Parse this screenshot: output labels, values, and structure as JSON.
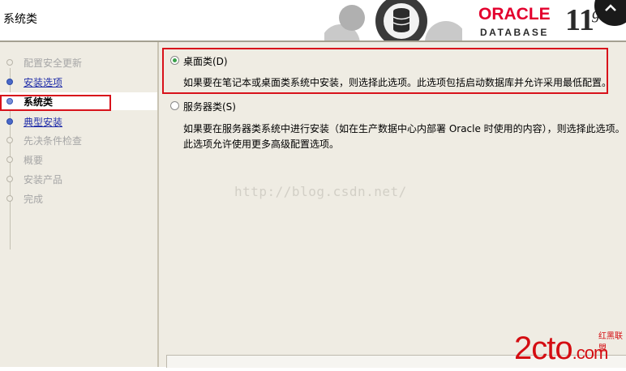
{
  "header": {
    "title": "系统类",
    "brand": "ORACLE",
    "product": "DATABASE",
    "version": "11",
    "version_suffix": "g"
  },
  "nav": {
    "steps": [
      {
        "label": "配置安全更新",
        "state": "done"
      },
      {
        "label": "安装选项",
        "state": "link"
      },
      {
        "label": "系统类",
        "state": "current"
      },
      {
        "label": "典型安装",
        "state": "link"
      },
      {
        "label": "先决条件检查",
        "state": "pending"
      },
      {
        "label": "概要",
        "state": "pending"
      },
      {
        "label": "安装产品",
        "state": "pending"
      },
      {
        "label": "完成",
        "state": "pending"
      }
    ]
  },
  "options": {
    "desktop": {
      "label": "桌面类(D)",
      "selected": true,
      "description": "如果要在笔记本或桌面类系统中安装，则选择此选项。此选项包括启动数据库并允许采用最低配置。"
    },
    "server": {
      "label": "服务器类(S)",
      "selected": false,
      "description_line1": "如果要在服务器类系统中进行安装（如在生产数据中心内部署 Oracle 时使用的内容），则选择此选项。",
      "description_line2": "此选项允许使用更多高级配置选项。"
    }
  },
  "watermark": "http://blog.csdn.net/",
  "site_logo": {
    "main": "2cto",
    "suffix": ".com",
    "sub": "红黑联盟"
  },
  "colors": {
    "highlight_box": "#d8121b",
    "oracle_red": "#e3002d",
    "panel_bg": "#efece3",
    "link_blue": "#1f2ca8"
  }
}
